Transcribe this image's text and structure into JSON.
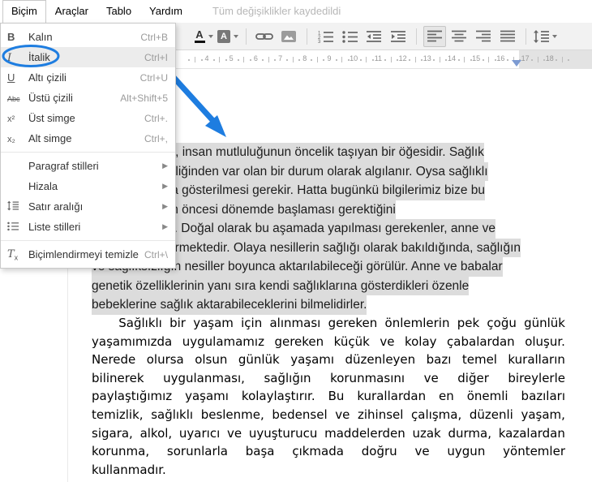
{
  "ui_colors": {
    "annotation_blue": "#1e7de0",
    "selection_gray": "#dcdcdc",
    "ruler_marker_blue": "#7d9bd2"
  },
  "menubar": {
    "items": [
      {
        "label": "Biçim",
        "active": true
      },
      {
        "label": "Araçlar"
      },
      {
        "label": "Tablo"
      },
      {
        "label": "Yardım"
      }
    ],
    "save_status": "Tüm değişiklikler kaydedildi"
  },
  "toolbar": {
    "buttons": [
      {
        "icon": "text-color",
        "caret": true,
        "name": "text-color-button"
      },
      {
        "icon": "highlight-color",
        "caret": true,
        "name": "highlight-color-button"
      },
      {
        "sep": true
      },
      {
        "icon": "insert-link",
        "name": "insert-link-button"
      },
      {
        "icon": "insert-image",
        "name": "insert-image-button"
      },
      {
        "sep": true
      },
      {
        "icon": "numbered-list",
        "name": "numbered-list-button"
      },
      {
        "icon": "bulleted-list",
        "name": "bulleted-list-button"
      },
      {
        "icon": "decrease-indent",
        "name": "decrease-indent-button"
      },
      {
        "icon": "increase-indent",
        "name": "increase-indent-button"
      },
      {
        "sep": true
      },
      {
        "icon": "align-left",
        "active": true,
        "name": "align-left-button"
      },
      {
        "icon": "align-center",
        "name": "align-center-button"
      },
      {
        "icon": "align-right",
        "name": "align-right-button"
      },
      {
        "icon": "align-justify",
        "name": "align-justify-button"
      },
      {
        "sep": true
      },
      {
        "icon": "line-spacing",
        "caret": true,
        "name": "line-spacing-toolbar-button"
      }
    ]
  },
  "ruler": {
    "numbers": [
      "4",
      "5",
      "6",
      "7",
      "8",
      "9",
      "10",
      "11",
      "12",
      "13",
      "14",
      "15",
      "16",
      "17",
      "18"
    ]
  },
  "format_menu": {
    "groups": [
      [
        {
          "icon": "bold",
          "label": "Kalın",
          "shortcut": "Ctrl+B"
        },
        {
          "icon": "italic",
          "label": "İtalik",
          "shortcut": "Ctrl+I",
          "highlighted": true,
          "circled": true
        },
        {
          "icon": "underline",
          "label": "Altı çizili",
          "shortcut": "Ctrl+U"
        },
        {
          "icon": "strikethrough",
          "label": "Üstü çizili",
          "shortcut": "Alt+Shift+5"
        },
        {
          "icon": "superscript",
          "label": "Üst simge",
          "shortcut": "Ctrl+."
        },
        {
          "icon": "subscript",
          "label": "Alt simge",
          "shortcut": "Ctrl+,"
        }
      ],
      [
        {
          "label": "Paragraf stilleri",
          "submenu": true
        },
        {
          "label": "Hizala",
          "submenu": true
        },
        {
          "icon": "line-spacing",
          "label": "Satır aralığı",
          "submenu": true
        },
        {
          "icon": "list-styles",
          "label": "Liste stilleri",
          "submenu": true
        }
      ],
      [
        {
          "icon": "clear-formatting",
          "label": "Biçimlendirmeyi temizle",
          "shortcut": "Ctrl+\\"
        }
      ]
    ]
  },
  "document": {
    "paragraph1": {
      "selected": true,
      "lines": [
        "Sağlık, insan mutluluğunun öncelik taşıyan bir öğesidir. Sağlık",
        "çoğu kez kendiliğinden var olan bir durum olarak algılanır. Oysa sağlıklı",
        "olmak için çaba gösterilmesi gerekir. Hatta bugünkü bilgilerimiz bize bu",
        "çabanın doğum öncesi dönemde başlaması gerektiğini",
        "göstermektedir. Doğal olarak bu aşamada yapılması gerekenler, anne ve",
        "babayı ilgilendirmektedir. Olaya nesillerin sağlığı olarak bakıldığında, sağlığın",
        "ve sağlıksızlığın nesiller boyunca aktarılabileceği görülür. Anne ve babalar",
        "genetik özelliklerinin yanı sıra kendi sağlıklarına gösterdikleri özenle",
        "bebeklerine sağlık aktarabileceklerini bilmelidirler."
      ]
    },
    "paragraph2": {
      "justified": true,
      "lines": [
        "Sağlıklı bir yaşam için alınması gereken önlemlerin pek çoğu günlük",
        "yaşamımızda uygulamamız gereken küçük ve kolay çabalardan oluşur.",
        "Nerede olursa olsun günlük yaşamı düzenleyen bazı temel kuralların",
        "bilinerek uygulanması, sağlığın korunmasını ve diğer bireylerle",
        "paylaştığımız yaşamı kolaylaştırır. Bu kurallardan en önemli bazıları",
        "temizlik, sağlıklı beslenme, bedensel ve zihinsel çalışma, düzenli yaşam,",
        "sigara, alkol, uyarıcı ve uyuşturucu maddelerden uzak durma, kazalardan",
        "korunma, sorunlarla başa çıkmada doğru ve uygun yöntemler",
        "kullanmadır."
      ]
    }
  }
}
